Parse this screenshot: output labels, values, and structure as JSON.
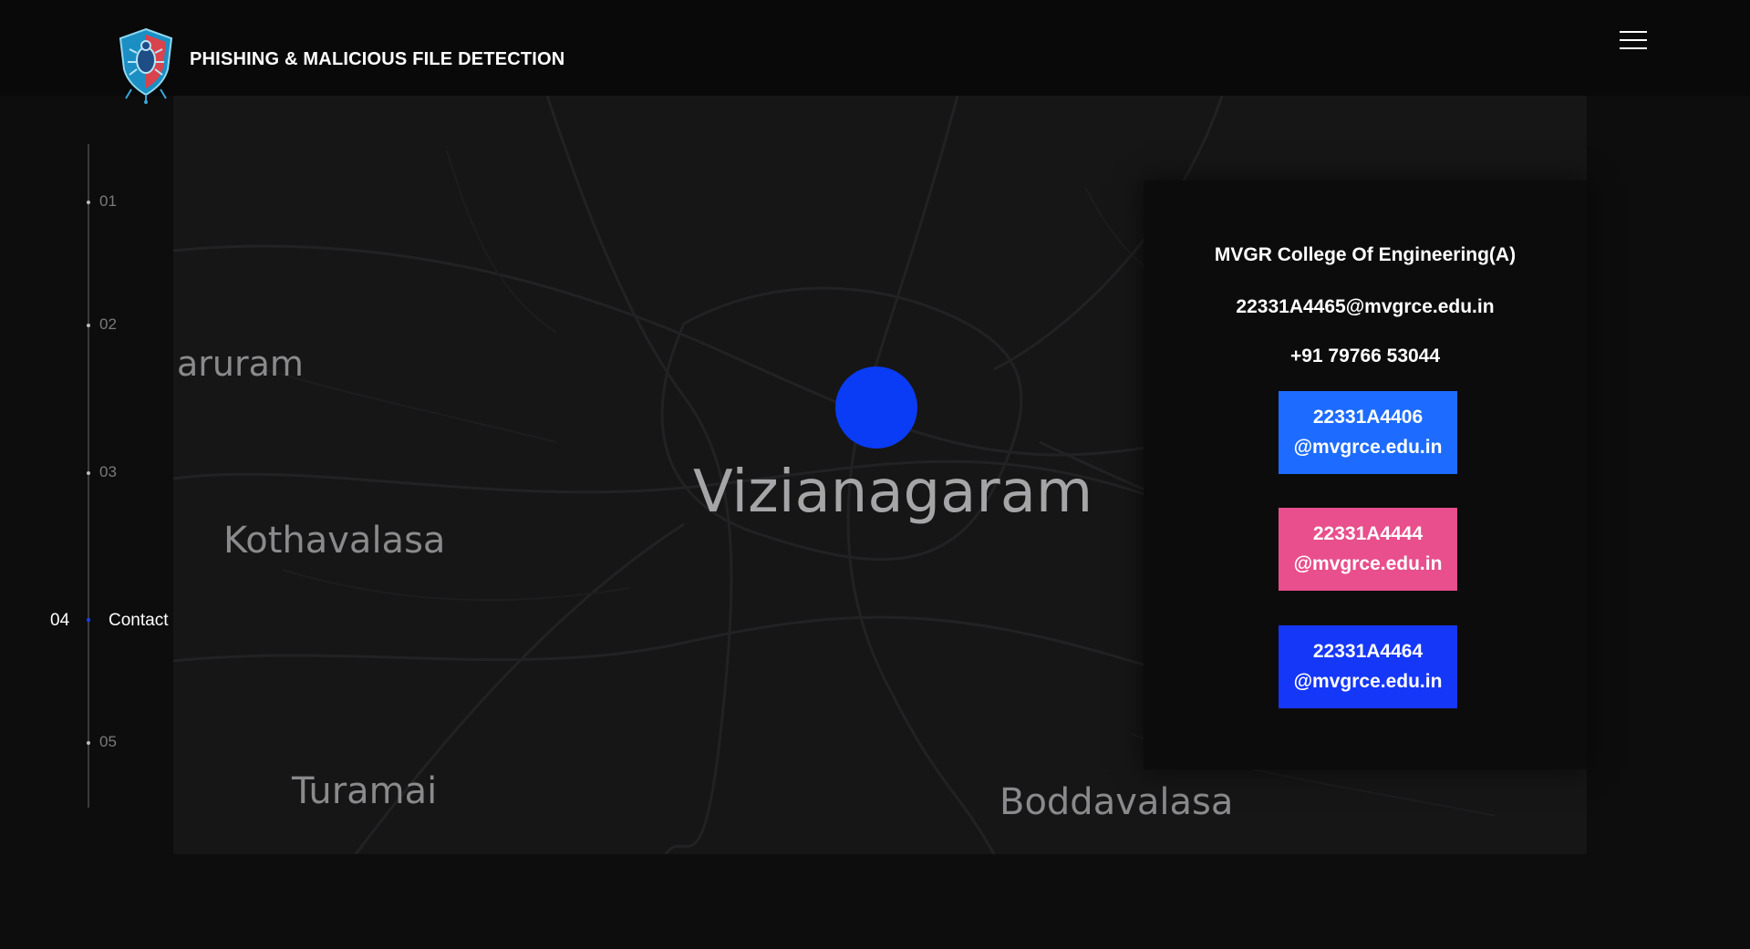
{
  "header": {
    "brand": "PHISHING & MALICIOUS FILE DETECTION",
    "logo_icon": "shield-bug-icon",
    "menu_icon": "hamburger-menu-icon"
  },
  "map": {
    "places": {
      "aruram": "aruram",
      "kothavalasa": "Kothavalasa",
      "vizianagaram": "Vizianagaram",
      "turamai": "Turamai",
      "boddavalasa": "Boddavalasa"
    },
    "marker_color": "#0a3cf5"
  },
  "contact": {
    "college": "MVGR College Of Engineering(A)",
    "email": "22331A4465@mvgrce.edu.in",
    "phone": "+91 79766 53044",
    "buttons": [
      {
        "line1": "22331A4406",
        "line2": "@mvgrce.edu.in",
        "color": "#1e6cff"
      },
      {
        "line1": "22331A4444",
        "line2": "@mvgrce.edu.in",
        "color": "#e84f8c"
      },
      {
        "line1": "22331A4464",
        "line2": "@mvgrce.edu.in",
        "color": "#1537f7"
      }
    ]
  },
  "sidenav": {
    "items": [
      "01",
      "02",
      "03",
      "04",
      "05"
    ],
    "active_number": "04",
    "active_label": "Contact"
  }
}
